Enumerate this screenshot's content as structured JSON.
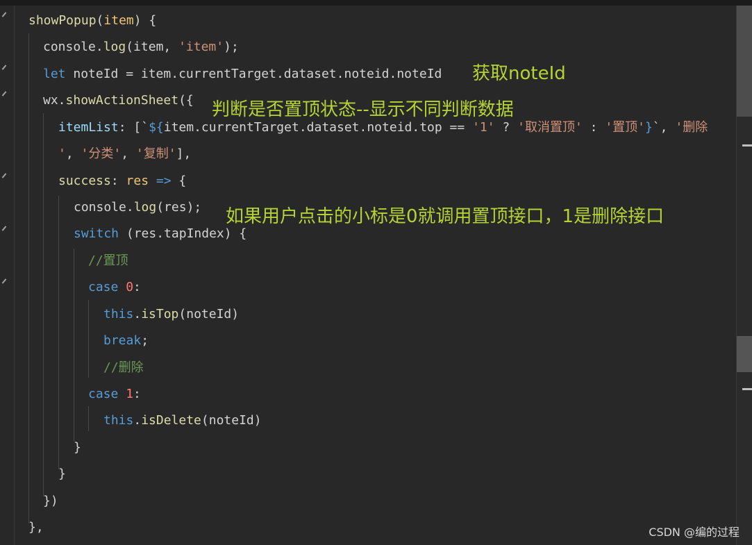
{
  "code_lines": [
    {
      "tokens": [
        {
          "t": "showPopup",
          "c": "fn"
        },
        {
          "t": "(",
          "c": "default"
        },
        {
          "t": "item",
          "c": "prop"
        },
        {
          "t": ") {",
          "c": "default"
        }
      ]
    },
    {
      "tokens": [
        {
          "t": "console",
          "c": "default"
        },
        {
          "t": ".",
          "c": "default"
        },
        {
          "t": "log",
          "c": "fn"
        },
        {
          "t": "(item, ",
          "c": "default"
        },
        {
          "t": "'item'",
          "c": "str"
        },
        {
          "t": ");",
          "c": "default"
        }
      ]
    },
    {
      "tokens": [
        {
          "t": "let",
          "c": "kw"
        },
        {
          "t": " noteId = item.currentTarget.dataset.noteid.noteId",
          "c": "default"
        }
      ]
    },
    {
      "tokens": [
        {
          "t": "wx.",
          "c": "default"
        },
        {
          "t": "showActionSheet",
          "c": "fn"
        },
        {
          "t": "({",
          "c": "default"
        }
      ]
    },
    {
      "tokens": [
        {
          "t": "itemList",
          "c": "var"
        },
        {
          "t": ": [`",
          "c": "default"
        },
        {
          "t": "${",
          "c": "kw"
        },
        {
          "t": "item.currentTarget.dataset.noteid.top == ",
          "c": "default"
        },
        {
          "t": "'1'",
          "c": "str"
        },
        {
          "t": " ? ",
          "c": "default"
        },
        {
          "t": "'取消置顶'",
          "c": "str"
        },
        {
          "t": " : ",
          "c": "default"
        },
        {
          "t": "'置顶'",
          "c": "str"
        },
        {
          "t": "}",
          "c": "kw"
        },
        {
          "t": "`, ",
          "c": "default"
        },
        {
          "t": "'删除",
          "c": "str"
        }
      ]
    },
    {
      "tokens": [
        {
          "t": "'",
          "c": "str"
        },
        {
          "t": ", ",
          "c": "default"
        },
        {
          "t": "'分类'",
          "c": "str"
        },
        {
          "t": ", ",
          "c": "default"
        },
        {
          "t": "'复制'",
          "c": "str"
        },
        {
          "t": "],",
          "c": "default"
        }
      ]
    },
    {
      "tokens": [
        {
          "t": "success",
          "c": "fn"
        },
        {
          "t": ": ",
          "c": "default"
        },
        {
          "t": "res",
          "c": "prop"
        },
        {
          "t": " ",
          "c": "default"
        },
        {
          "t": "=>",
          "c": "kw"
        },
        {
          "t": " {",
          "c": "default"
        }
      ]
    },
    {
      "tokens": [
        {
          "t": "console",
          "c": "default"
        },
        {
          "t": ".",
          "c": "default"
        },
        {
          "t": "log",
          "c": "fn"
        },
        {
          "t": "(res);",
          "c": "default"
        }
      ]
    },
    {
      "tokens": [
        {
          "t": "switch",
          "c": "kw"
        },
        {
          "t": " (res.tapIndex) {",
          "c": "default"
        }
      ]
    },
    {
      "tokens": [
        {
          "t": "//置顶",
          "c": "cm"
        }
      ]
    },
    {
      "tokens": [
        {
          "t": "case",
          "c": "kw"
        },
        {
          "t": " ",
          "c": "default"
        },
        {
          "t": "0",
          "c": "num"
        },
        {
          "t": ":",
          "c": "default"
        }
      ]
    },
    {
      "tokens": [
        {
          "t": "this",
          "c": "kw"
        },
        {
          "t": ".",
          "c": "default"
        },
        {
          "t": "isTop",
          "c": "fn"
        },
        {
          "t": "(noteId)",
          "c": "default"
        }
      ]
    },
    {
      "tokens": [
        {
          "t": "break",
          "c": "kw"
        },
        {
          "t": ";",
          "c": "default"
        }
      ]
    },
    {
      "tokens": [
        {
          "t": "//删除",
          "c": "cm"
        }
      ]
    },
    {
      "tokens": [
        {
          "t": "case",
          "c": "kw"
        },
        {
          "t": " ",
          "c": "default"
        },
        {
          "t": "1",
          "c": "num"
        },
        {
          "t": ":",
          "c": "default"
        }
      ]
    },
    {
      "tokens": [
        {
          "t": "this",
          "c": "kw"
        },
        {
          "t": ".",
          "c": "default"
        },
        {
          "t": "isDelete",
          "c": "fn"
        },
        {
          "t": "(noteId)",
          "c": "default"
        }
      ]
    },
    {
      "tokens": [
        {
          "t": "}",
          "c": "default"
        }
      ]
    },
    {
      "tokens": [
        {
          "t": "}",
          "c": "default"
        }
      ]
    },
    {
      "tokens": [
        {
          "t": "})",
          "c": "default"
        }
      ]
    },
    {
      "tokens": [
        {
          "t": "},",
          "c": "default"
        }
      ]
    }
  ],
  "annotations": {
    "get_note_id": "获取noteId",
    "top_state": "判断是否置顶状态--显示不同判断数据",
    "tap_index": "如果用户点击的小标是0就调用置顶接口，1是删除接口"
  },
  "watermark": "CSDN @编的过程",
  "colors": {
    "background": "#282828",
    "keyword": "#569cd6",
    "function": "#dcdcaa",
    "string": "#ce9178",
    "comment": "#6a9955",
    "annotation": "#b5d334"
  }
}
